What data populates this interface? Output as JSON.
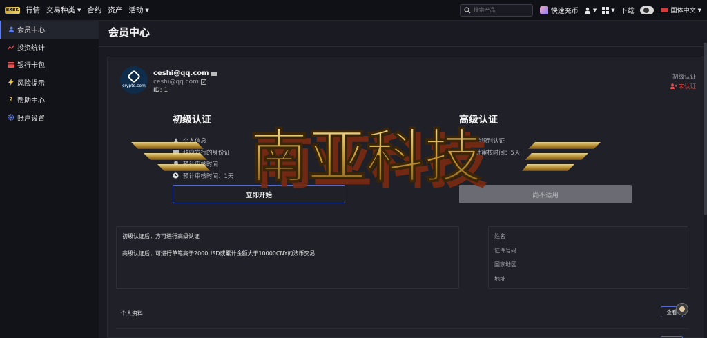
{
  "nav": {
    "logo_text": "BXBK",
    "items": [
      {
        "label": "行情",
        "has_caret": false
      },
      {
        "label": "交易种类",
        "has_caret": true
      },
      {
        "label": "合约",
        "has_caret": false
      },
      {
        "label": "资产",
        "has_caret": false
      },
      {
        "label": "活动",
        "has_caret": true
      }
    ],
    "search_placeholder": "搜索产品",
    "quick_buy": "快速充币",
    "download": "下载",
    "language": "国体中文"
  },
  "sidebar": {
    "items": [
      {
        "label": "会员中心",
        "icon": "user-icon",
        "active": true,
        "color": "#5d7cf0"
      },
      {
        "label": "投资统计",
        "icon": "chart-icon",
        "active": false,
        "color": "#e05252"
      },
      {
        "label": "银行卡包",
        "icon": "card-icon",
        "active": false,
        "color": "#e05252"
      },
      {
        "label": "风险提示",
        "icon": "lightning-icon",
        "active": false,
        "color": "#f2c94c"
      },
      {
        "label": "帮助中心",
        "icon": "question-icon",
        "active": false,
        "color": "#f2c94c"
      },
      {
        "label": "账户设置",
        "icon": "gear-icon",
        "active": false,
        "color": "#5d7cf0"
      }
    ]
  },
  "page": {
    "title": "会员中心"
  },
  "user": {
    "avatar_text": "crypto.com",
    "email_strong": "ceshi@qq.com",
    "email": "ceshi@qq.com",
    "id": "ID: 1"
  },
  "cert_status": {
    "label": "初级认证",
    "value": "未认证",
    "value_color": "#e05252"
  },
  "basic_level": {
    "title": "初级认证",
    "requirements": [
      "个人信息",
      "政府发行的身份证",
      "预计审核时间",
      "预计审核时间：1天"
    ],
    "button": "立即开始"
  },
  "advanced_level": {
    "title": "高级认证",
    "requirements": [
      "人脸识别认证",
      "预计审核时间：5天"
    ],
    "button": "尚不适用"
  },
  "notes": [
    "初级认证后，方可进行高级认证",
    "高级认证后，可进行单笔高于2000USD或累计金额大于10000CNY的法币交易"
  ],
  "info_fields": [
    "姓名",
    "证件号码",
    "国家地区",
    "地址"
  ],
  "profile": {
    "label": "个人资料",
    "edit_button": "查看"
  },
  "watermark": {
    "text": "南亚科技"
  }
}
